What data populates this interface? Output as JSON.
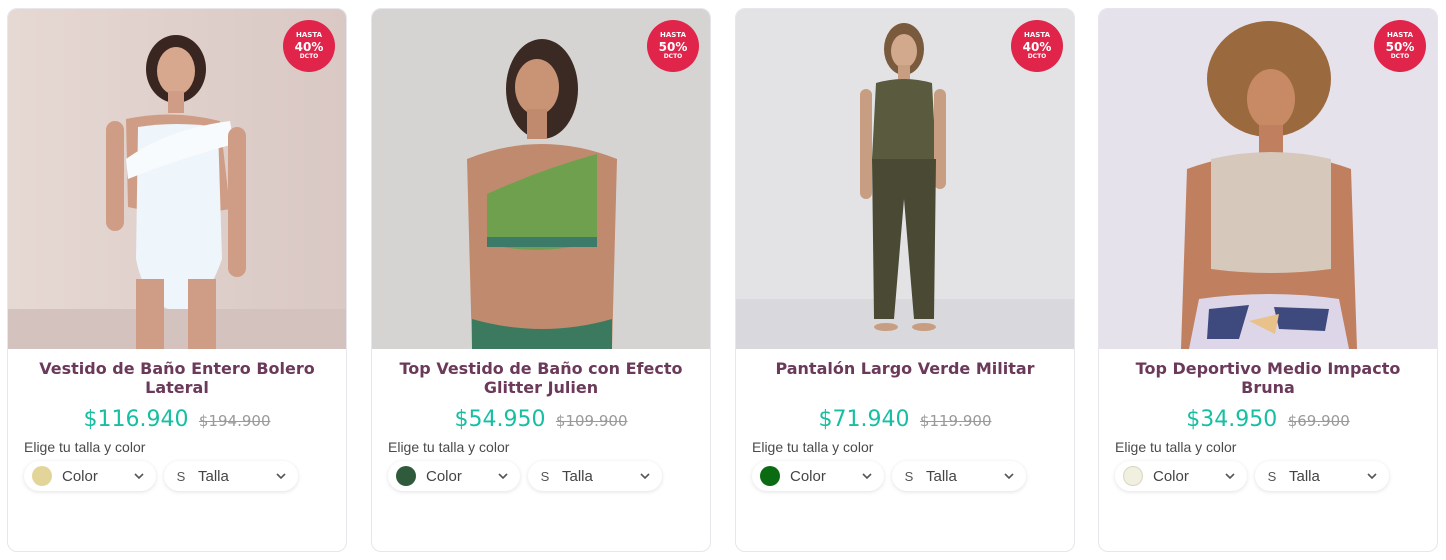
{
  "products": [
    {
      "badge": {
        "top": "HASTA",
        "pct": "40%",
        "bottom": "DCTO"
      },
      "title": "Vestido de Baño Entero Bolero Lateral",
      "price": "$116.940",
      "old_price": "$194.900",
      "choose_label": "Elige tu talla y color",
      "color_label": "Color",
      "size_label": "Talla",
      "size_icon": "S",
      "swatch_color": "#e3d59a"
    },
    {
      "badge": {
        "top": "HASTA",
        "pct": "50%",
        "bottom": "DCTO"
      },
      "title": "Top Vestido de Baño con Efecto Glitter Julien",
      "price": "$54.950",
      "old_price": "$109.900",
      "choose_label": "Elige tu talla y color",
      "color_label": "Color",
      "size_label": "Talla",
      "size_icon": "S",
      "swatch_color": "#2f5a3c"
    },
    {
      "badge": {
        "top": "HASTA",
        "pct": "40%",
        "bottom": "DCTO"
      },
      "title": "Pantalón Largo Verde Militar",
      "price": "$71.940",
      "old_price": "$119.900",
      "choose_label": "Elige tu talla y color",
      "color_label": "Color",
      "size_label": "Talla",
      "size_icon": "S",
      "swatch_color": "#0b6b12"
    },
    {
      "badge": {
        "top": "HASTA",
        "pct": "50%",
        "bottom": "DCTO"
      },
      "title": "Top Deportivo Medio Impacto Bruna",
      "price": "$34.950",
      "old_price": "$69.900",
      "choose_label": "Elige tu talla y color",
      "color_label": "Color",
      "size_label": "Talla",
      "size_icon": "S",
      "swatch_color": "#f0efe0"
    }
  ],
  "colors": {
    "badge": "#e0244a",
    "price": "#16bfa3",
    "title": "#6b3a5a",
    "old_price": "#9a9a9a"
  }
}
